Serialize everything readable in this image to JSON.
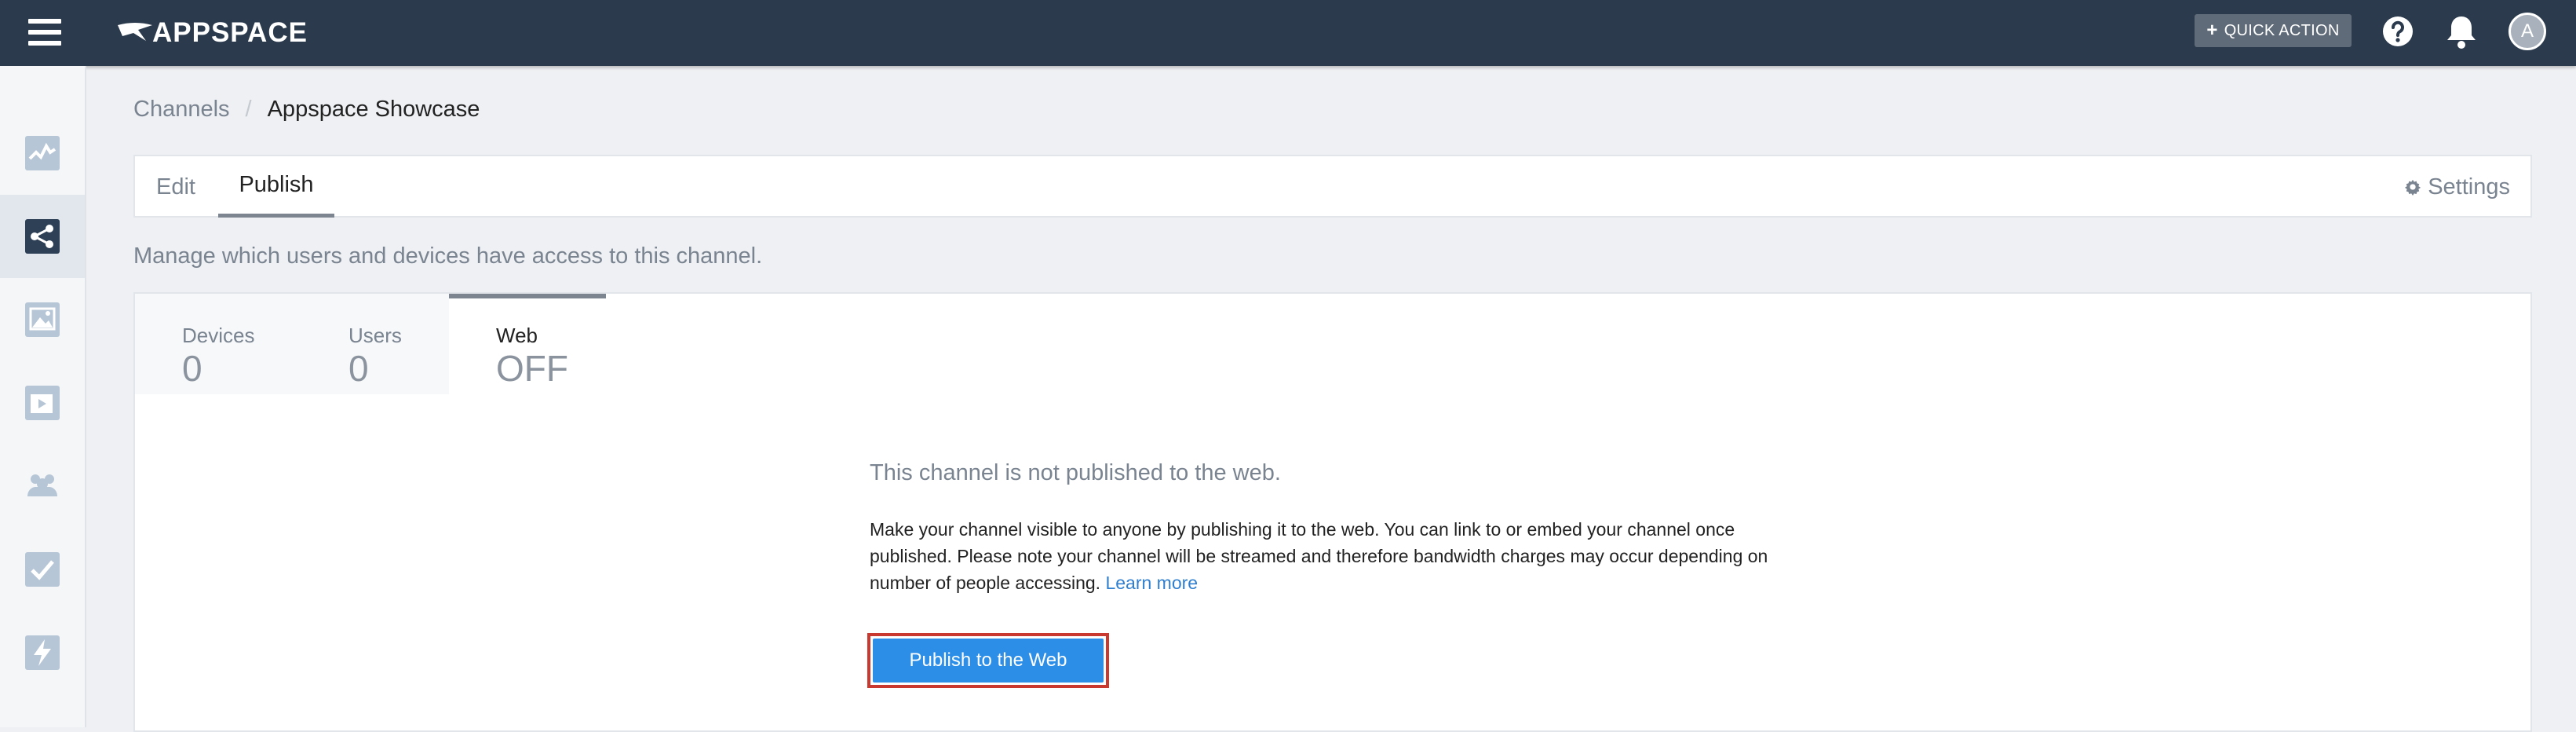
{
  "topbar": {
    "brand": "APPSPACE",
    "quick_action_label": "QUICK ACTION",
    "quick_action_icon": "plus-icon",
    "avatar_initial": "A"
  },
  "sidebar": {
    "items": [
      {
        "icon": "activity-chart-icon",
        "active": false
      },
      {
        "icon": "share-channel-icon",
        "active": true
      },
      {
        "icon": "image-library-icon",
        "active": false
      },
      {
        "icon": "video-playlist-icon",
        "active": false
      },
      {
        "icon": "users-group-icon",
        "active": false
      },
      {
        "icon": "checkmark-tasks-icon",
        "active": false
      },
      {
        "icon": "lightning-icon",
        "active": false
      }
    ]
  },
  "breadcrumb": {
    "parent": "Channels",
    "separator": "/",
    "current": "Appspace Showcase"
  },
  "tabs": {
    "edit": "Edit",
    "publish": "Publish",
    "active": "Publish",
    "settings": "Settings"
  },
  "subtitle": "Manage which users and devices have access to this channel.",
  "access": {
    "devices": {
      "label": "Devices",
      "value": "0"
    },
    "users": {
      "label": "Users",
      "value": "0"
    },
    "web": {
      "label": "Web",
      "value": "OFF"
    }
  },
  "web_panel": {
    "heading": "This channel is not published to the web.",
    "description": "Make your channel visible to anyone by publishing it to the web. You can link to or embed your channel once published. Please note your channel will be streamed and therefore bandwidth charges may occur depending on number of people accessing.",
    "learn_more": "Learn more",
    "publish_button": "Publish to the Web"
  },
  "colors": {
    "topbar": "#2b3a4d",
    "accent_button": "#2d8ee7",
    "highlight_border": "#c9392f",
    "link": "#2f7fd1"
  }
}
